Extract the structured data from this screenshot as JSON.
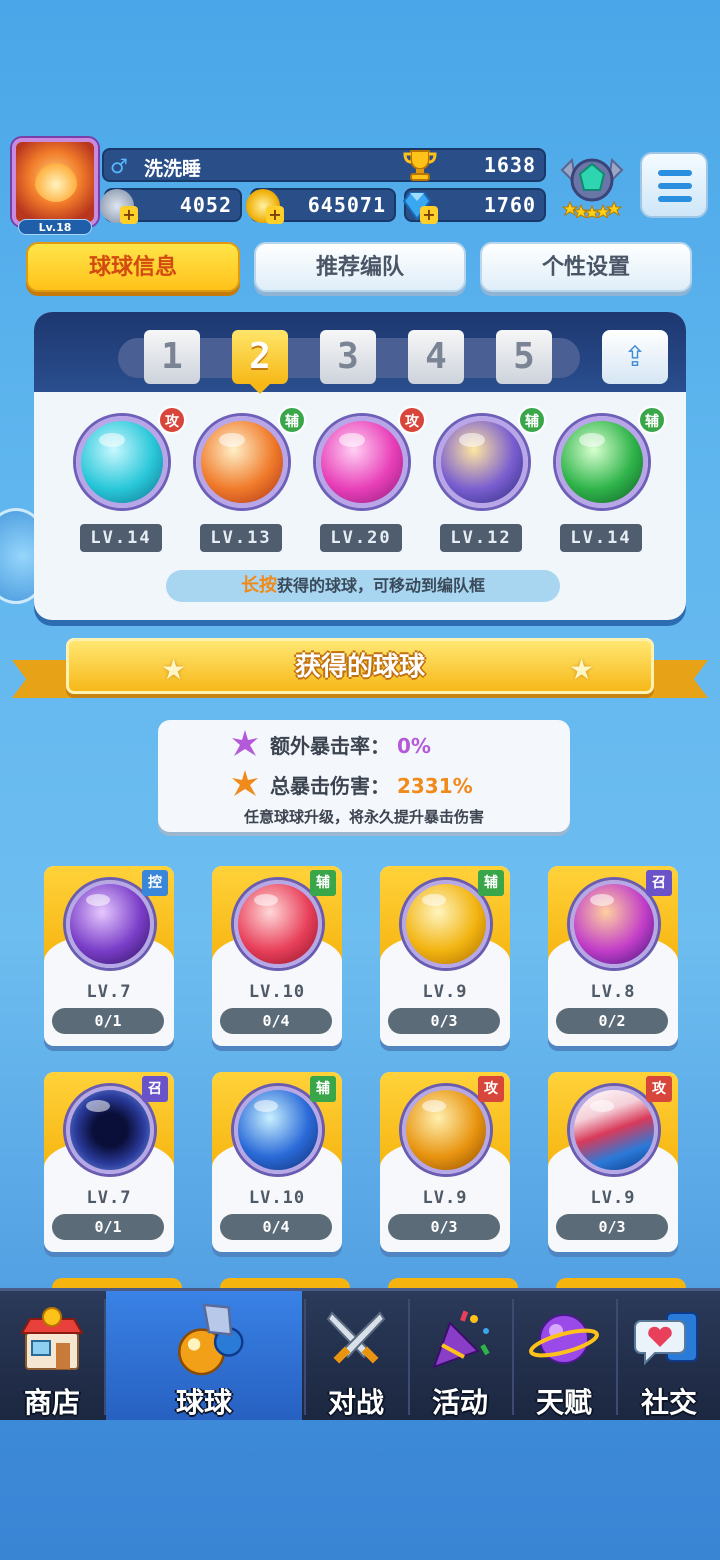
{
  "player": {
    "level": "Lv.18",
    "gender_symbol": "♂",
    "name": "洗洗睡",
    "trophies": "1638",
    "energy": "4052",
    "coins": "645071",
    "gems": "1760"
  },
  "tabs": [
    {
      "label": "球球信息",
      "active": true
    },
    {
      "label": "推荐编队",
      "active": false
    },
    {
      "label": "个性设置",
      "active": false
    }
  ],
  "team": {
    "slots": [
      "1",
      "2",
      "3",
      "4",
      "5"
    ],
    "selected_slot": "2",
    "members": [
      {
        "role": "攻",
        "level": "LV.14",
        "color": "#29c7d9"
      },
      {
        "role": "辅",
        "level": "LV.13",
        "color": "#f07a2a"
      },
      {
        "role": "攻",
        "level": "LV.20",
        "color": "#e83fb8"
      },
      {
        "role": "辅",
        "level": "LV.12",
        "color": "#7a5ed0"
      },
      {
        "role": "辅",
        "level": "LV.14",
        "color": "#2fb44a"
      }
    ],
    "hint_highlight": "长按",
    "hint_text": "获得的球球，可移动到编队框"
  },
  "collection": {
    "title": "获得的球球",
    "extra_crit_label": "额外暴击率：",
    "extra_crit_value": "0%",
    "total_crit_label": "总暴击伤害：",
    "total_crit_value": "2331%",
    "crit_note": "任意球球升级，将永久提升暴击伤害",
    "cards": [
      {
        "role": "控",
        "level": "LV.7",
        "progress": "0/1",
        "color": "#7a3ec8"
      },
      {
        "role": "辅",
        "level": "LV.10",
        "progress": "0/4",
        "color": "#e8405a"
      },
      {
        "role": "辅",
        "level": "LV.9",
        "progress": "0/3",
        "color": "#f2b410"
      },
      {
        "role": "召",
        "level": "LV.8",
        "progress": "0/2",
        "color": "#c23ec8"
      },
      {
        "role": "召",
        "level": "LV.7",
        "progress": "0/1",
        "color": "#2a3a9a"
      },
      {
        "role": "辅",
        "level": "LV.10",
        "progress": "0/4",
        "color": "#2a6ad8"
      },
      {
        "role": "攻",
        "level": "LV.9",
        "progress": "0/3",
        "color": "#e89410"
      },
      {
        "role": "攻",
        "level": "LV.9",
        "progress": "0/3",
        "color": "#d83a5a"
      }
    ]
  },
  "nav": [
    {
      "label": "商店",
      "icon": "shop-icon",
      "active": false
    },
    {
      "label": "球球",
      "icon": "ball-icon",
      "active": true
    },
    {
      "label": "对战",
      "icon": "crossed-swords-icon",
      "active": false
    },
    {
      "label": "活动",
      "icon": "party-popper-icon",
      "active": false
    },
    {
      "label": "天赋",
      "icon": "planet-icon",
      "active": false
    },
    {
      "label": "社交",
      "icon": "chat-heart-icon",
      "active": false
    }
  ]
}
